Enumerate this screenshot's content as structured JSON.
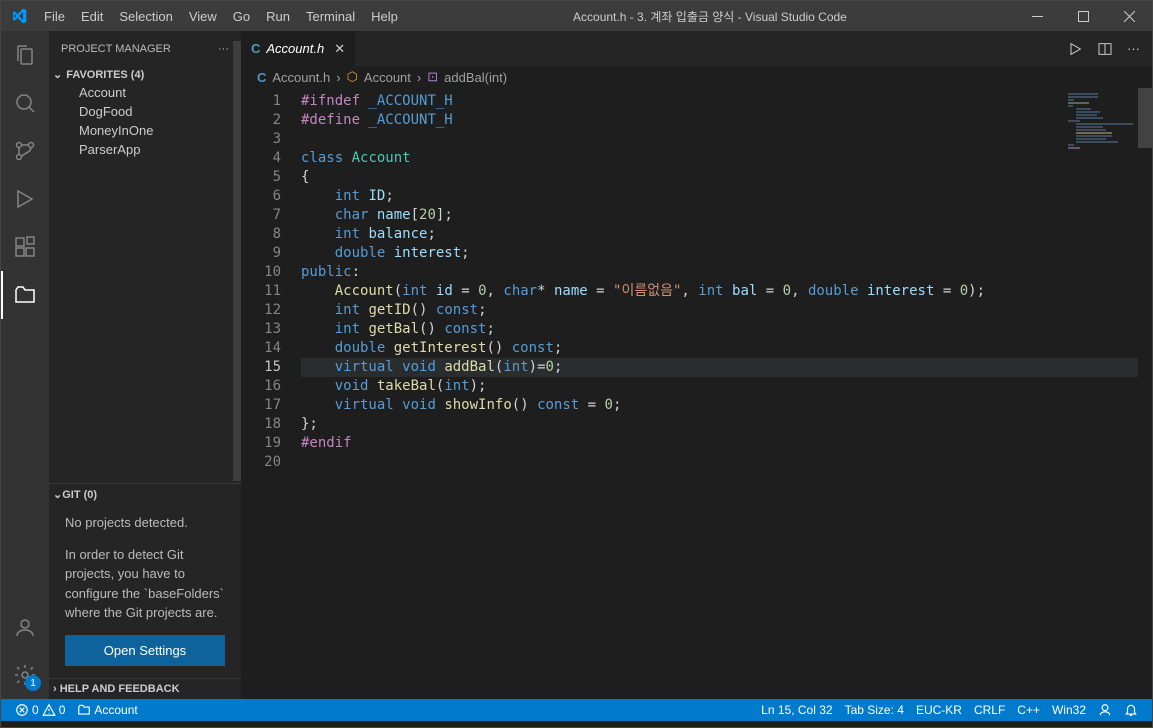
{
  "titlebar": {
    "menu": [
      "File",
      "Edit",
      "Selection",
      "View",
      "Go",
      "Run",
      "Terminal",
      "Help"
    ],
    "title": "Account.h - 3. 계좌 입출금 양식 - Visual Studio Code"
  },
  "sidebar": {
    "header": "PROJECT MANAGER",
    "favorites_label": "FAVORITES (4)",
    "favorites": [
      "Account",
      "DogFood",
      "MoneyInOne",
      "ParserApp"
    ],
    "git_label": "GIT (0)",
    "git_msg1": "No projects detected.",
    "git_msg2": "In order to detect Git projects, you have to configure the `baseFolders` where the Git projects are.",
    "git_button": "Open Settings",
    "help_label": "HELP AND FEEDBACK"
  },
  "tab": {
    "label": "Account.h"
  },
  "breadcrumb": {
    "file": "Account.h",
    "sym1": "Account",
    "sym2": "addBal(int)"
  },
  "code": {
    "lines": 20,
    "highlight": 15
  },
  "statusbar": {
    "errors": "0",
    "warnings": "0",
    "branch": "Account",
    "ln_col": "Ln 15, Col 32",
    "tab": "Tab Size: 4",
    "encoding": "EUC-KR",
    "eol": "CRLF",
    "lang": "C++",
    "win": "Win32"
  },
  "gear_badge": "1"
}
